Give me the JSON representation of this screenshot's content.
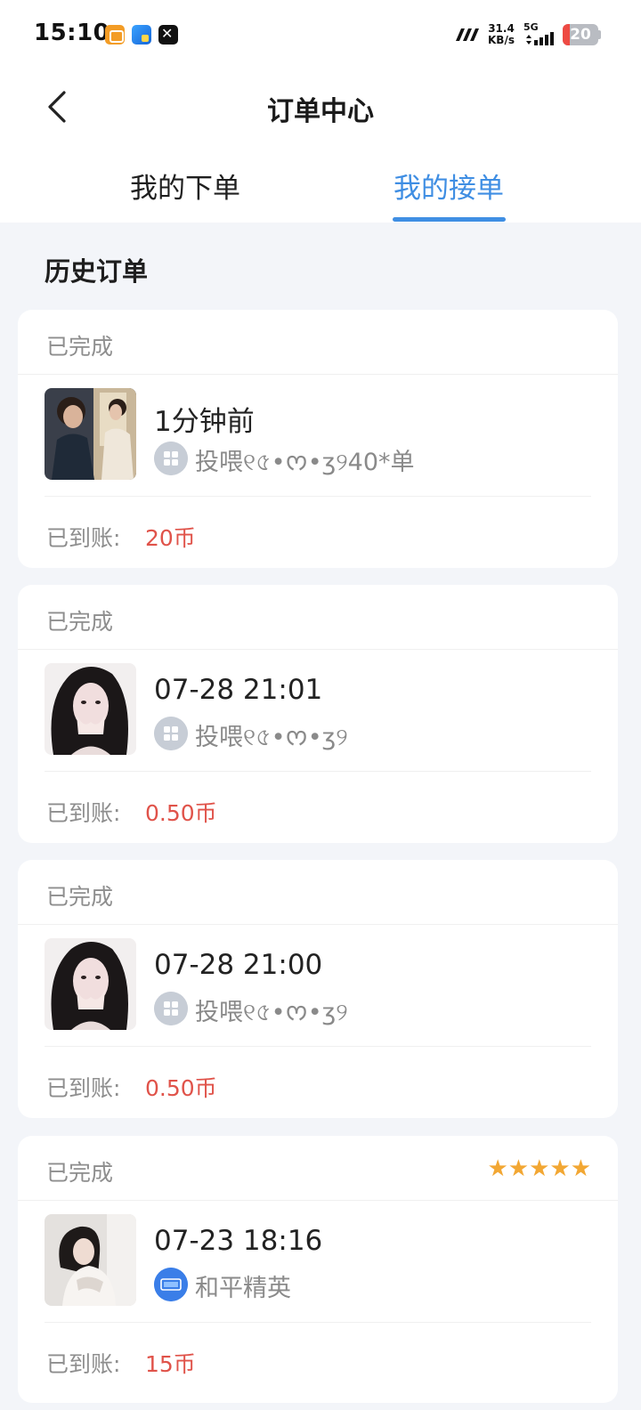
{
  "status_bar": {
    "time": "15:10",
    "net_speed_value": "31.4",
    "net_speed_unit": "KB/s",
    "network": "5G",
    "battery": "20",
    "battery_color": "#ee4a43"
  },
  "header": {
    "title": "订单中心",
    "back_icon": "chevron-left-icon"
  },
  "tabs": [
    {
      "label": "我的下单",
      "active": false
    },
    {
      "label": "我的接单",
      "active": true
    }
  ],
  "accent_color": "#3f8ee3",
  "price_color": "#e0534a",
  "section_title": "历史订单",
  "orders": [
    {
      "status": "已完成",
      "time": "1分钟前",
      "game": "投喂୧৫•ᰔ•ʒ୨40*单",
      "paid_label": "已到账:",
      "paid_value": "20币",
      "rating": ""
    },
    {
      "status": "已完成",
      "time": "07-28 21:01",
      "game": "投喂୧৫•ᰔ•ʒ୨",
      "paid_label": "已到账:",
      "paid_value": "0.50币",
      "rating": ""
    },
    {
      "status": "已完成",
      "time": "07-28 21:00",
      "game": "投喂୧৫•ᰔ•ʒ୨",
      "paid_label": "已到账:",
      "paid_value": "0.50币",
      "rating": ""
    },
    {
      "status": "已完成",
      "time": "07-23 18:16",
      "game": "和平精英",
      "paid_label": "已到账:",
      "paid_value": "15币",
      "rating": "★★★★★"
    }
  ]
}
